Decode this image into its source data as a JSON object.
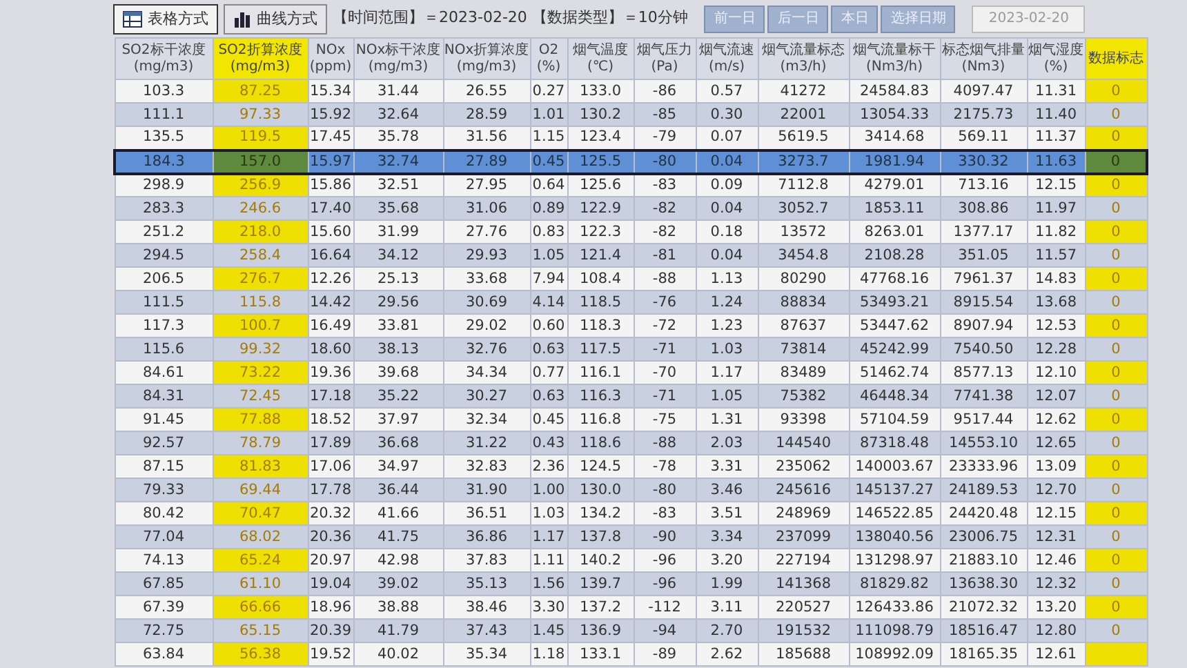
{
  "toolbar": {
    "view_tabs": [
      {
        "label": "表格方式",
        "kind": "table",
        "selected": true
      },
      {
        "label": "曲线方式",
        "kind": "chart",
        "selected": false
      }
    ],
    "time_range": "【时间范围】＝2023-02-20 【数据类型】＝10分钟",
    "buttons": [
      "前一日",
      "后一日",
      "本日",
      "选择日期"
    ],
    "date_field": {
      "value": "2023-02-20"
    }
  },
  "table": {
    "columns": [
      {
        "name": "SO2标干浓度",
        "unit": "(mg/m3)",
        "highlighted": false
      },
      {
        "name": "SO2折算浓度",
        "unit": "(mg/m3)",
        "highlighted": true
      },
      {
        "name": "NOx",
        "unit": "(ppm)",
        "highlighted": false
      },
      {
        "name": "NOx标干浓度",
        "unit": "(mg/m3)",
        "highlighted": false
      },
      {
        "name": "NOx折算浓度",
        "unit": "(mg/m3)",
        "highlighted": false
      },
      {
        "name": "O2",
        "unit": "(%)",
        "highlighted": false
      },
      {
        "name": "烟气温度",
        "unit": "(℃)",
        "highlighted": false
      },
      {
        "name": "烟气压力",
        "unit": "(Pa)",
        "highlighted": false
      },
      {
        "name": "烟气流速",
        "unit": "(m/s)",
        "highlighted": false
      },
      {
        "name": "烟气流量标态",
        "unit": "(m3/h)",
        "highlighted": false
      },
      {
        "name": "烟气流量标干",
        "unit": "(Nm3/h)",
        "highlighted": false
      },
      {
        "name": "标态烟气排量",
        "unit": "(Nm3)",
        "highlighted": false
      },
      {
        "name": "烟气湿度",
        "unit": "(%)",
        "highlighted": false
      },
      {
        "name": "数据标志",
        "highlighted": true
      }
    ],
    "rows": [
      {
        "selected": false,
        "cells": [
          "103.3",
          "87.25",
          "15.34",
          "31.44",
          "26.55",
          "0.27",
          "133.0",
          "-86",
          "0.57",
          "41272",
          "24584.83",
          "4097.47",
          "11.31",
          "0"
        ]
      },
      {
        "selected": false,
        "cells": [
          "111.1",
          "97.33",
          "15.92",
          "32.64",
          "28.59",
          "1.01",
          "130.2",
          "-85",
          "0.30",
          "22001",
          "13054.33",
          "2175.73",
          "11.40",
          "0"
        ]
      },
      {
        "selected": false,
        "cells": [
          "135.5",
          "119.5",
          "17.45",
          "35.78",
          "31.56",
          "1.15",
          "123.4",
          "-79",
          "0.07",
          "5619.5",
          "3414.68",
          "569.11",
          "11.37",
          "0"
        ]
      },
      {
        "selected": true,
        "cells": [
          "184.3",
          "157.0",
          "15.97",
          "32.74",
          "27.89",
          "0.45",
          "125.5",
          "-80",
          "0.04",
          "3273.7",
          "1981.94",
          "330.32",
          "11.63",
          "0"
        ]
      },
      {
        "selected": false,
        "cells": [
          "298.9",
          "256.9",
          "15.86",
          "32.51",
          "27.95",
          "0.64",
          "125.6",
          "-83",
          "0.09",
          "7112.8",
          "4279.01",
          "713.16",
          "12.15",
          "0"
        ]
      },
      {
        "selected": false,
        "cells": [
          "283.3",
          "246.6",
          "17.40",
          "35.68",
          "31.06",
          "0.89",
          "122.9",
          "-82",
          "0.04",
          "3052.7",
          "1853.11",
          "308.86",
          "11.97",
          "0"
        ]
      },
      {
        "selected": false,
        "cells": [
          "251.2",
          "218.0",
          "15.60",
          "31.99",
          "27.76",
          "0.83",
          "122.3",
          "-82",
          "0.18",
          "13572",
          "8263.01",
          "1377.17",
          "11.82",
          "0"
        ]
      },
      {
        "selected": false,
        "cells": [
          "294.5",
          "258.4",
          "16.64",
          "34.12",
          "29.93",
          "1.05",
          "121.4",
          "-81",
          "0.04",
          "3454.8",
          "2108.28",
          "351.05",
          "11.57",
          "0"
        ]
      },
      {
        "selected": false,
        "cells": [
          "206.5",
          "276.7",
          "12.26",
          "25.13",
          "33.68",
          "7.94",
          "108.4",
          "-88",
          "1.13",
          "80290",
          "47768.16",
          "7961.37",
          "14.83",
          "0"
        ]
      },
      {
        "selected": false,
        "cells": [
          "111.5",
          "115.8",
          "14.42",
          "29.56",
          "30.69",
          "4.14",
          "118.5",
          "-76",
          "1.24",
          "88834",
          "53493.21",
          "8915.54",
          "13.68",
          "0"
        ]
      },
      {
        "selected": false,
        "cells": [
          "117.3",
          "100.7",
          "16.49",
          "33.81",
          "29.02",
          "0.60",
          "118.3",
          "-72",
          "1.23",
          "87637",
          "53447.62",
          "8907.94",
          "12.53",
          "0"
        ]
      },
      {
        "selected": false,
        "cells": [
          "115.6",
          "99.32",
          "18.60",
          "38.13",
          "32.76",
          "0.63",
          "117.5",
          "-71",
          "1.03",
          "73814",
          "45242.99",
          "7540.50",
          "12.28",
          "0"
        ]
      },
      {
        "selected": false,
        "cells": [
          "84.61",
          "73.22",
          "19.36",
          "39.68",
          "34.34",
          "0.77",
          "116.1",
          "-70",
          "1.17",
          "83489",
          "51462.74",
          "8577.13",
          "12.10",
          "0"
        ]
      },
      {
        "selected": false,
        "cells": [
          "84.31",
          "72.45",
          "17.18",
          "35.22",
          "30.27",
          "0.63",
          "116.3",
          "-71",
          "1.05",
          "75382",
          "46448.34",
          "7741.38",
          "12.07",
          "0"
        ]
      },
      {
        "selected": false,
        "cells": [
          "91.45",
          "77.88",
          "18.52",
          "37.97",
          "32.34",
          "0.45",
          "116.8",
          "-75",
          "1.31",
          "93398",
          "57104.59",
          "9517.44",
          "12.62",
          "0"
        ]
      },
      {
        "selected": false,
        "cells": [
          "92.57",
          "78.79",
          "17.89",
          "36.68",
          "31.22",
          "0.43",
          "118.6",
          "-88",
          "2.03",
          "144540",
          "87318.48",
          "14553.10",
          "12.65",
          "0"
        ]
      },
      {
        "selected": false,
        "cells": [
          "87.15",
          "81.83",
          "17.06",
          "34.97",
          "32.83",
          "2.36",
          "124.5",
          "-78",
          "3.31",
          "235062",
          "140003.67",
          "23333.96",
          "13.09",
          "0"
        ]
      },
      {
        "selected": false,
        "cells": [
          "79.33",
          "69.44",
          "17.78",
          "36.44",
          "31.90",
          "1.00",
          "130.0",
          "-80",
          "3.46",
          "245616",
          "145137.27",
          "24189.53",
          "12.70",
          "0"
        ]
      },
      {
        "selected": false,
        "cells": [
          "80.42",
          "70.47",
          "20.32",
          "41.66",
          "36.51",
          "1.03",
          "134.2",
          "-83",
          "3.51",
          "248969",
          "146522.85",
          "24420.48",
          "12.15",
          "0"
        ]
      },
      {
        "selected": false,
        "cells": [
          "77.04",
          "68.02",
          "20.36",
          "41.75",
          "36.86",
          "1.17",
          "137.8",
          "-90",
          "3.34",
          "237099",
          "138040.56",
          "23006.75",
          "12.31",
          "0"
        ]
      },
      {
        "selected": false,
        "cells": [
          "74.13",
          "65.24",
          "20.97",
          "42.98",
          "37.83",
          "1.11",
          "140.2",
          "-96",
          "3.20",
          "227194",
          "131298.97",
          "21883.10",
          "12.46",
          "0"
        ]
      },
      {
        "selected": false,
        "cells": [
          "67.85",
          "61.10",
          "19.04",
          "39.02",
          "35.13",
          "1.56",
          "139.7",
          "-96",
          "1.99",
          "141368",
          "81829.82",
          "13638.30",
          "12.32",
          "0"
        ]
      },
      {
        "selected": false,
        "cells": [
          "67.39",
          "66.66",
          "18.96",
          "38.88",
          "38.46",
          "3.30",
          "137.2",
          "-112",
          "3.11",
          "220527",
          "126433.86",
          "21072.32",
          "13.20",
          "0"
        ]
      },
      {
        "selected": false,
        "cells": [
          "72.75",
          "65.15",
          "20.39",
          "41.79",
          "37.43",
          "1.45",
          "136.9",
          "-94",
          "2.70",
          "191532",
          "111098.79",
          "18516.47",
          "12.80",
          "0"
        ]
      },
      {
        "selected": false,
        "cells": [
          "63.84",
          "56.38",
          "19.52",
          "40.02",
          "35.34",
          "1.18",
          "133.1",
          "-89",
          "2.62",
          "185688",
          "108992.09",
          "18165.35",
          "12.61"
        ]
      }
    ]
  }
}
